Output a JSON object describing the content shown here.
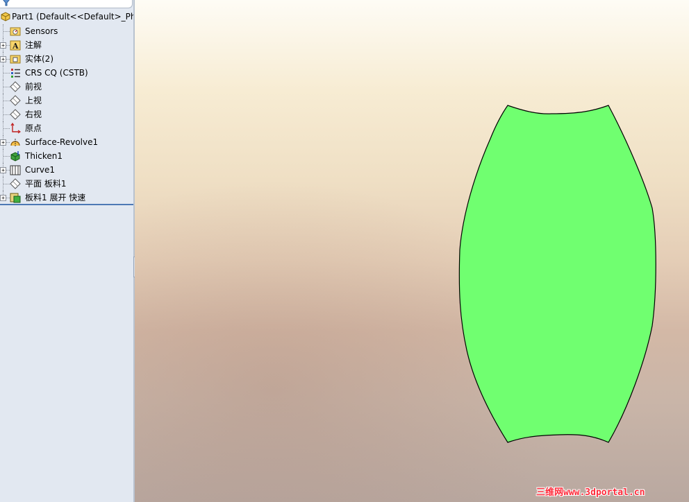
{
  "tree": {
    "root_label": "Part1  (Default<<Default>_Pho",
    "items": [
      {
        "label": "Sensors",
        "icon": "sensors-folder-icon",
        "expandable": false
      },
      {
        "label": "注解",
        "icon": "annotations-folder-icon",
        "expandable": true
      },
      {
        "label": "实体(2)",
        "icon": "solid-bodies-folder-icon",
        "expandable": true
      },
      {
        "label": "CRS CQ (CSTB)",
        "icon": "material-icon",
        "expandable": false
      },
      {
        "label": "前视",
        "icon": "plane-icon",
        "expandable": false
      },
      {
        "label": "上视",
        "icon": "plane-icon",
        "expandable": false
      },
      {
        "label": "右视",
        "icon": "plane-icon",
        "expandable": false
      },
      {
        "label": "原点",
        "icon": "origin-icon",
        "expandable": false
      },
      {
        "label": "Surface-Revolve1",
        "icon": "surface-revolve-icon",
        "expandable": true
      },
      {
        "label": "Thicken1",
        "icon": "thicken-icon",
        "expandable": false
      },
      {
        "label": "Curve1",
        "icon": "curve-icon",
        "expandable": true
      },
      {
        "label": "平面 板料1",
        "icon": "plane-icon",
        "expandable": false
      },
      {
        "label": "板料1 展开 快速",
        "icon": "flatten-icon",
        "expandable": true
      }
    ]
  },
  "viewport": {
    "part_color": "#70ff70",
    "watermark": "三维网www.3dportal.cn"
  }
}
